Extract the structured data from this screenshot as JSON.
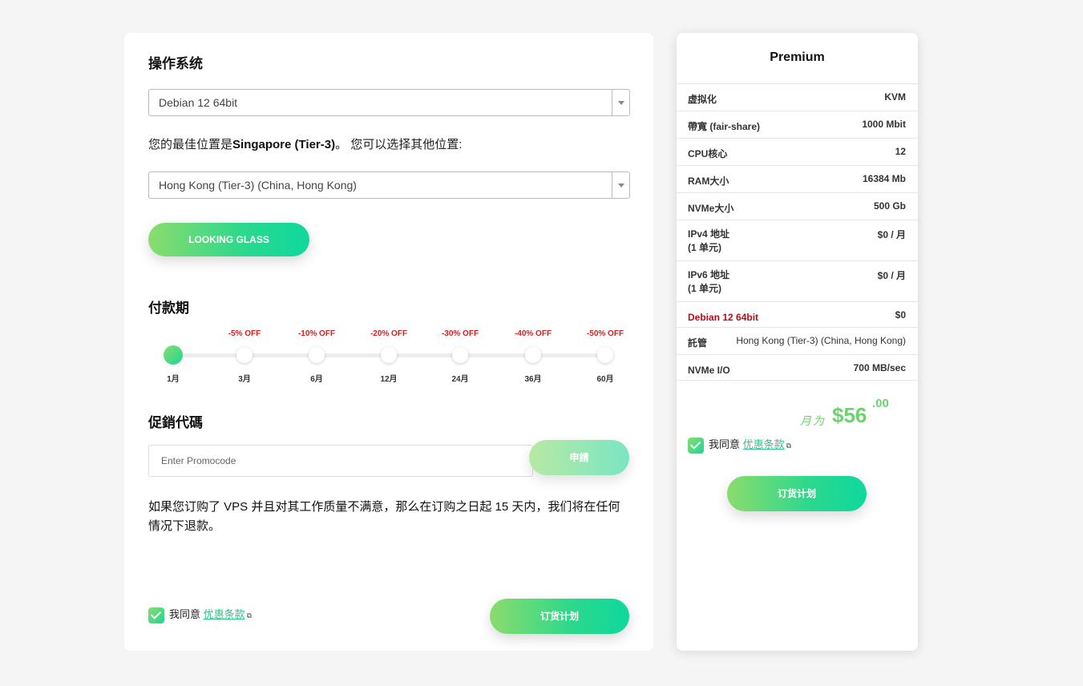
{
  "os_section": {
    "title": "操作系统",
    "selected": "Debian 12 64bit"
  },
  "location_section": {
    "prefix": "您的最佳位置是",
    "best": "Singapore (Tier-3)",
    "suffix": "。 您可以选择其他位置:",
    "selected": "Hong Kong (Tier-3) (China, Hong Kong)"
  },
  "looking_glass_label": "LOOKING GLASS",
  "payment_section": {
    "title": "付款期",
    "periods": [
      {
        "label": "1月",
        "discount": ""
      },
      {
        "label": "3月",
        "discount": "-5% OFF"
      },
      {
        "label": "6月",
        "discount": "-10% OFF"
      },
      {
        "label": "12月",
        "discount": "-20% OFF"
      },
      {
        "label": "24月",
        "discount": "-30% OFF"
      },
      {
        "label": "36月",
        "discount": "-40% OFF"
      },
      {
        "label": "60月",
        "discount": "-50% OFF"
      }
    ],
    "selected_index": 0
  },
  "promo_section": {
    "title": "促銷代碼",
    "placeholder": "Enter Promocode",
    "apply_label": "申請"
  },
  "refund_text": "如果您订购了 VPS 并且对其工作质量不满意，那么在订购之日起 15 天内，我们将在任何情况下退款。",
  "agree": {
    "text": "我同意",
    "link": "优惠条款"
  },
  "order_label": "订货计划",
  "plan": {
    "title": "Premium",
    "specs": [
      {
        "key": "虚拟化",
        "value": "KVM"
      },
      {
        "key": "帶寬 (fair-share)",
        "value": "1000 Mbit"
      },
      {
        "key": "CPU核心",
        "value": "12"
      },
      {
        "key": "RAM大小",
        "value": "16384 Mb"
      },
      {
        "key": "NVMe大小",
        "value": "500 Gb"
      },
      {
        "key": "IPv4 地址",
        "key2": "(1 单元)",
        "value": "$0 / 月"
      },
      {
        "key": "IPv6 地址",
        "key2": "(1 单元)",
        "value": "$0 / 月"
      },
      {
        "key": "Debian 12 64bit",
        "value": "$0"
      },
      {
        "key": "託管",
        "value": "Hong Kong (Tier-3) (China, Hong Kong)"
      },
      {
        "key": "NVMe I/O",
        "value": "700 MB/sec"
      }
    ],
    "price_per": "月为",
    "price_amount": "$56",
    "price_cents": ".00"
  },
  "colors": {
    "accent_start": "#8bdc6c",
    "accent_end": "#0fd89e",
    "discount_red": "#d21f1f",
    "os_red": "#b30d1a",
    "price_green": "#6bd36e"
  }
}
